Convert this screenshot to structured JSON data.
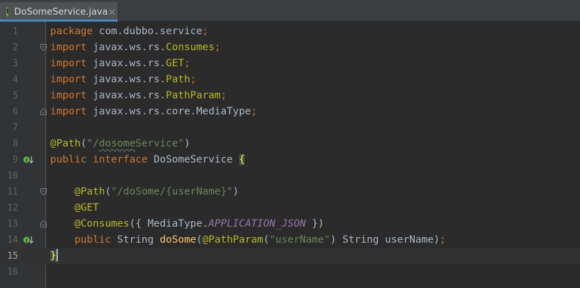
{
  "tab": {
    "icon": "java-interface-icon",
    "icon_letter": "I",
    "label": "DoSomeService.java",
    "close": "×"
  },
  "colors": {
    "background": "#2b2b2b",
    "gutter": "#313335",
    "keyword": "#cc7832",
    "string": "#6a8759",
    "annotation": "#bbb529",
    "constant": "#9876aa",
    "method": "#ffc66d",
    "text": "#a9b7c6",
    "line_number": "#606366",
    "current_line": "#323232",
    "implemented_marker": "#62b543"
  },
  "editor": {
    "current_line": 15,
    "lines": [
      {
        "num": "1",
        "tokens": [
          [
            "kw",
            "package"
          ],
          [
            "pln",
            " com.dubbo.service"
          ],
          [
            "kw",
            ";"
          ]
        ]
      },
      {
        "num": "2",
        "fold": "open",
        "tokens": [
          [
            "kw",
            "import"
          ],
          [
            "pln",
            " javax.ws.rs."
          ],
          [
            "ann",
            "Consumes"
          ],
          [
            "kw",
            ";"
          ]
        ]
      },
      {
        "num": "3",
        "tokens": [
          [
            "kw",
            "import"
          ],
          [
            "pln",
            " javax.ws.rs."
          ],
          [
            "ann",
            "GET"
          ],
          [
            "kw",
            ";"
          ]
        ]
      },
      {
        "num": "4",
        "tokens": [
          [
            "kw",
            "import"
          ],
          [
            "pln",
            " javax.ws.rs."
          ],
          [
            "ann",
            "Path"
          ],
          [
            "kw",
            ";"
          ]
        ]
      },
      {
        "num": "5",
        "tokens": [
          [
            "kw",
            "import"
          ],
          [
            "pln",
            " javax.ws.rs."
          ],
          [
            "ann",
            "PathParam"
          ],
          [
            "kw",
            ";"
          ]
        ]
      },
      {
        "num": "6",
        "fold": "close",
        "tokens": [
          [
            "kw",
            "import"
          ],
          [
            "pln",
            " javax.ws.rs.core.MediaType"
          ],
          [
            "kw",
            ";"
          ]
        ]
      },
      {
        "num": "7",
        "tokens": []
      },
      {
        "num": "8",
        "tokens": [
          [
            "ann",
            "@Path"
          ],
          [
            "pln",
            "("
          ],
          [
            "str",
            "\"/"
          ],
          [
            "str wavy",
            "dosome"
          ],
          [
            "str",
            "Service\""
          ],
          [
            "pln",
            ")"
          ]
        ]
      },
      {
        "num": "9",
        "marker": "implemented-icon",
        "tokens": [
          [
            "kw",
            "public interface"
          ],
          [
            "pln",
            " DoSomeService "
          ],
          [
            "brace-hl",
            "{"
          ]
        ]
      },
      {
        "num": "10",
        "tokens": []
      },
      {
        "num": "11",
        "fold": "open",
        "tokens": [
          [
            "pln",
            "    "
          ],
          [
            "ann",
            "@Path"
          ],
          [
            "pln",
            "("
          ],
          [
            "str",
            "\"/doSome/{userName}\""
          ],
          [
            "pln",
            ")"
          ]
        ]
      },
      {
        "num": "12",
        "tokens": [
          [
            "pln",
            "    "
          ],
          [
            "ann",
            "@GET"
          ]
        ]
      },
      {
        "num": "13",
        "fold": "close",
        "tokens": [
          [
            "pln",
            "    "
          ],
          [
            "ann",
            "@Consumes"
          ],
          [
            "pln",
            "({ MediaType."
          ],
          [
            "fld",
            "APPLICATION_JSON"
          ],
          [
            "pln",
            " })"
          ]
        ]
      },
      {
        "num": "14",
        "marker": "implemented-icon",
        "tokens": [
          [
            "pln",
            "    "
          ],
          [
            "kw",
            "public"
          ],
          [
            "pln",
            " String "
          ],
          [
            "meth",
            "doSome"
          ],
          [
            "pln",
            "("
          ],
          [
            "ann",
            "@PathParam"
          ],
          [
            "pln",
            "("
          ],
          [
            "str",
            "\"userName\""
          ],
          [
            "pln",
            ") String userName)"
          ],
          [
            "kw",
            ";"
          ]
        ]
      },
      {
        "num": "15",
        "tokens": [
          [
            "brace-hl",
            "}"
          ],
          [
            "caret",
            ""
          ]
        ]
      },
      {
        "num": "16",
        "tokens": []
      }
    ]
  }
}
